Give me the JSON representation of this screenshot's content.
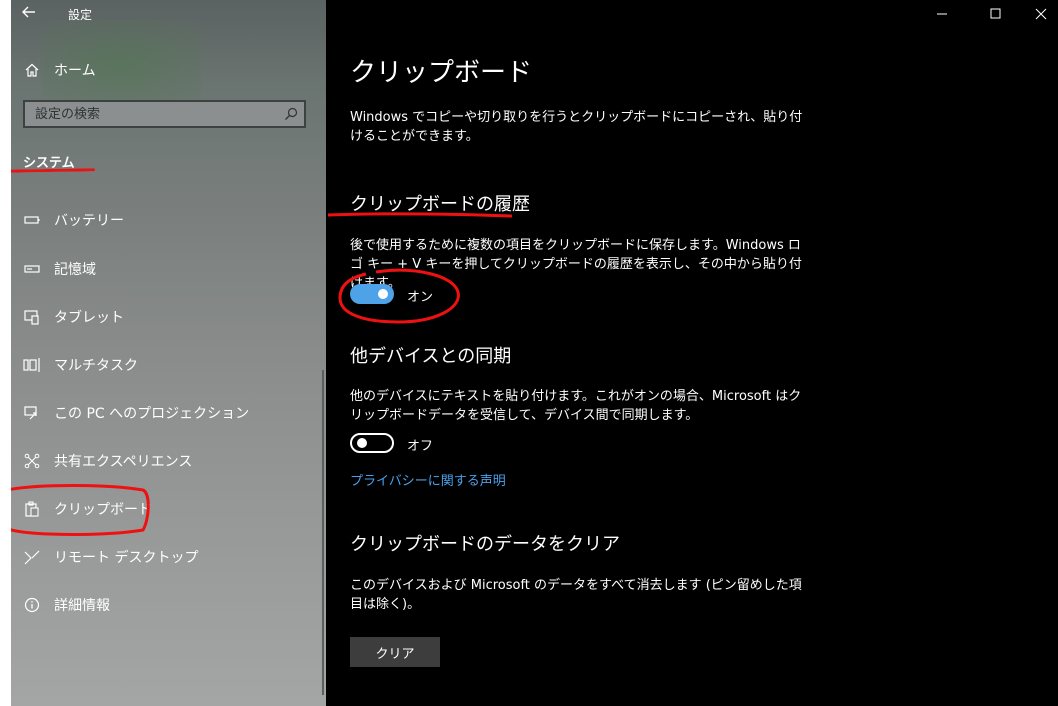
{
  "window": {
    "app_title": "設定",
    "controls": [
      "minimize-icon",
      "maximize-icon",
      "close-icon"
    ]
  },
  "sidebar": {
    "home_label": "ホーム",
    "search_placeholder": "設定の検索",
    "section_title": "システム",
    "items": [
      {
        "label": "バッテリー",
        "icon": "battery-icon"
      },
      {
        "label": "記憶域",
        "icon": "storage-icon"
      },
      {
        "label": "タブレット",
        "icon": "tablet-icon"
      },
      {
        "label": "マルチタスク",
        "icon": "multitasking-icon"
      },
      {
        "label": "この PC へのプロジェクション",
        "icon": "projection-icon"
      },
      {
        "label": "共有エクスペリエンス",
        "icon": "shared-experiences-icon"
      },
      {
        "label": "クリップボード",
        "icon": "clipboard-icon"
      },
      {
        "label": "リモート デスクトップ",
        "icon": "remote-desktop-icon"
      },
      {
        "label": "詳細情報",
        "icon": "info-icon"
      }
    ]
  },
  "content": {
    "title": "クリップボード",
    "intro": "Windows でコピーや切り取りを行うとクリップボードにコピーされ、貼り付けることができます。",
    "history": {
      "heading": "クリップボードの履歴",
      "description": "後で使用するために複数の項目をクリップボードに保存します。Windows ロゴ キー + V キーを押してクリップボードの履歴を表示し、その中から貼り付けます。",
      "toggle_state": "on",
      "toggle_label": "オン"
    },
    "sync": {
      "heading": "他デバイスとの同期",
      "description": "他のデバイスにテキストを貼り付けます。これがオンの場合、Microsoft はクリップボードデータを受信して、デバイス間で同期します。",
      "toggle_state": "off",
      "toggle_label": "オフ"
    },
    "privacy_link": "プライバシーに関する声明",
    "clear": {
      "heading": "クリップボードのデータをクリア",
      "description": "このデバイスおよび Microsoft のデータをすべて消去します (ピン留めした項目は除く)。",
      "button_label": "クリア"
    }
  },
  "colors": {
    "accent": "#4ea3e8",
    "link": "#4aa1ea",
    "annotation": "#e11111",
    "background": "#000000"
  }
}
